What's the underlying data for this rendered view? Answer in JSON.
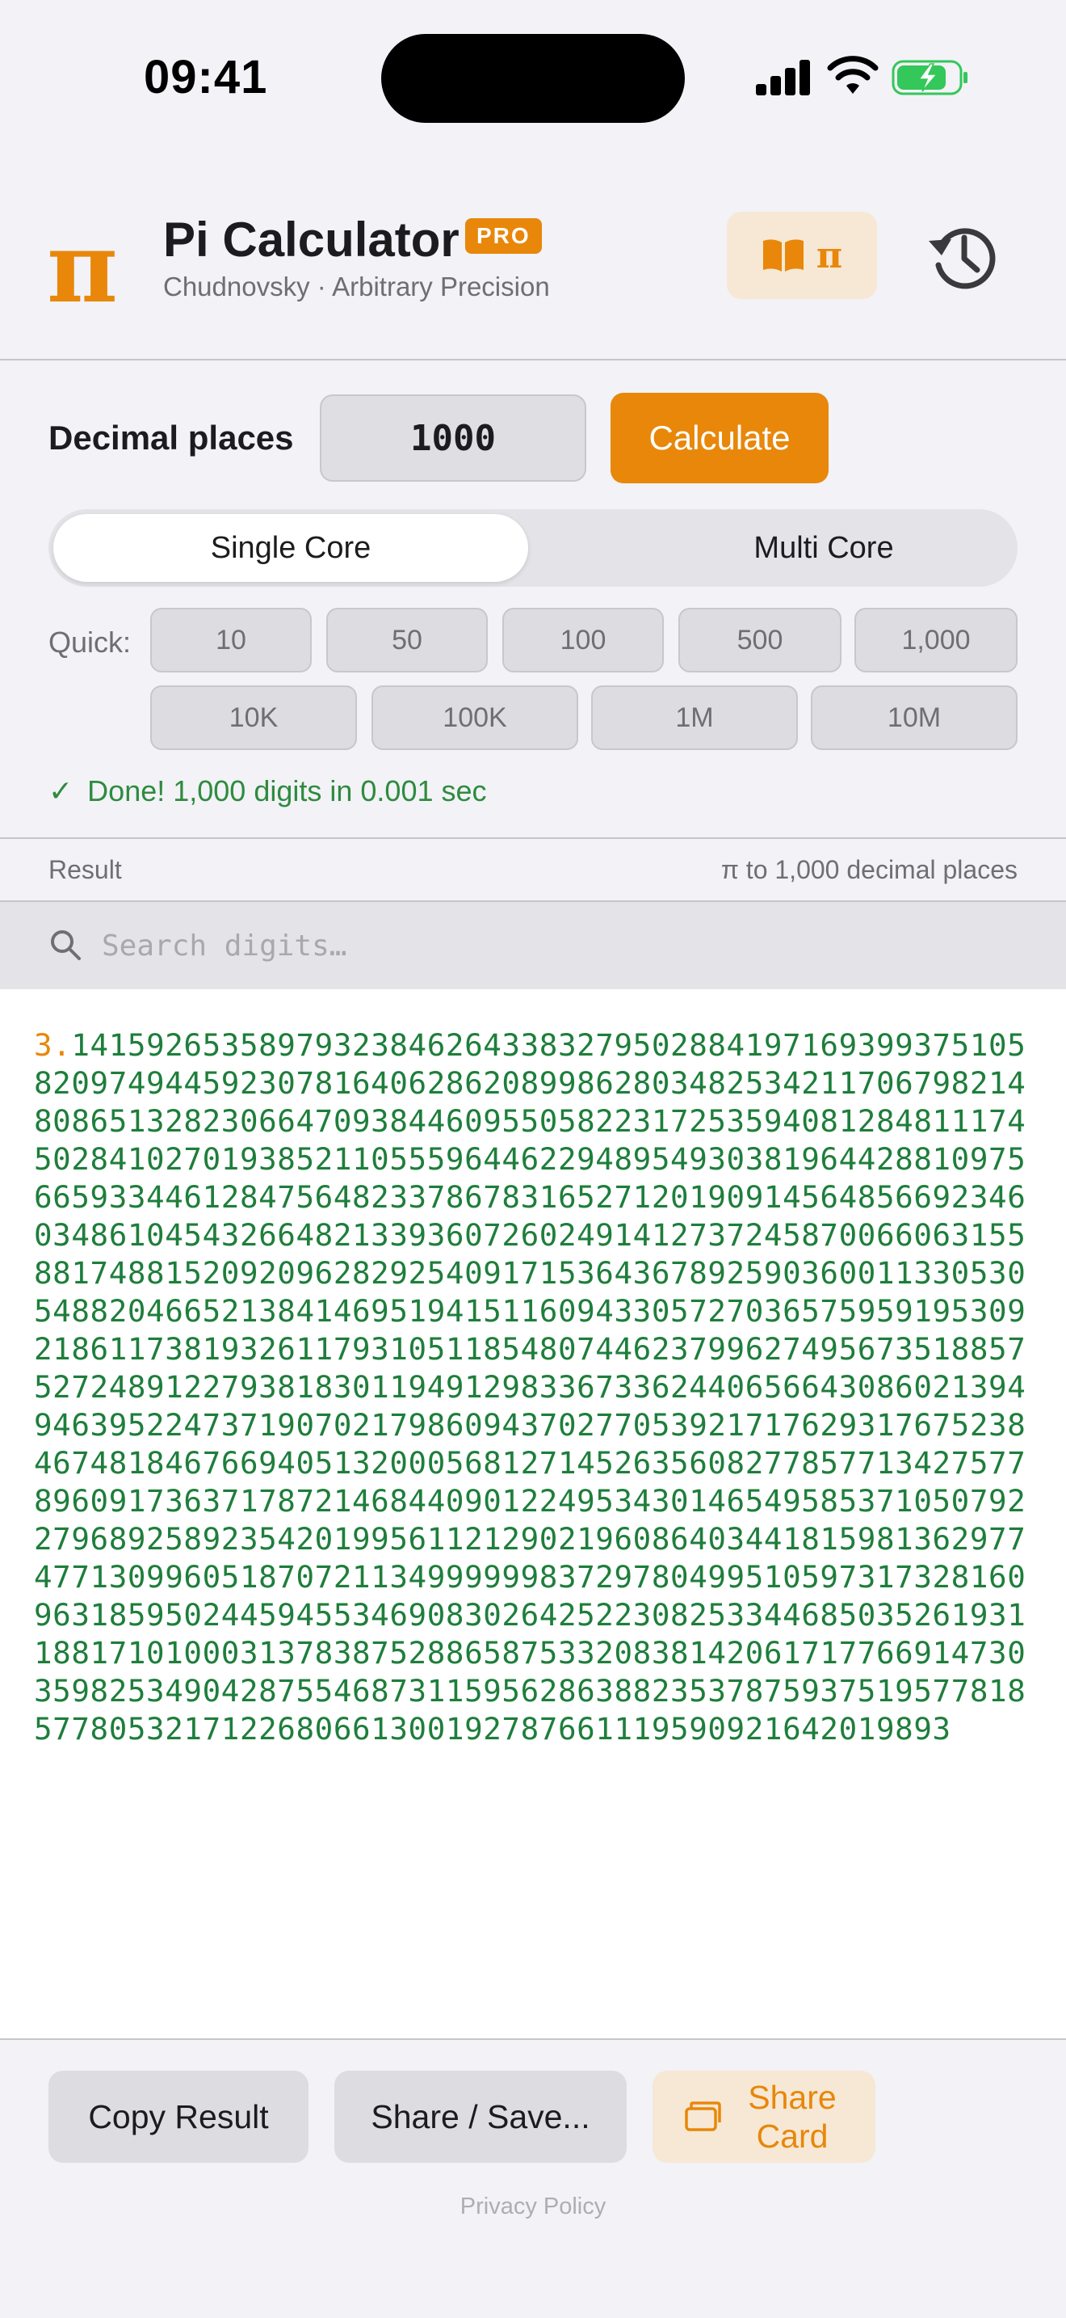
{
  "status_bar": {
    "time": "09:41"
  },
  "header": {
    "logo_glyph": "π",
    "title": "Pi Calculator",
    "badge": "PRO",
    "subtitle": "Chudnovsky · Arbitrary Precision",
    "book_button_glyph": "π",
    "icons": [
      "book-icon",
      "history-icon"
    ]
  },
  "controls": {
    "decimal_places_label": "Decimal places",
    "decimal_places_value": "1000",
    "calculate_label": "Calculate",
    "modes": [
      {
        "label": "Single Core",
        "selected": true
      },
      {
        "label": "Multi Core",
        "selected": false
      }
    ],
    "quick_label": "Quick:",
    "quick_row1": [
      "10",
      "50",
      "100",
      "500",
      "1,000"
    ],
    "quick_row2": [
      "10K",
      "100K",
      "1M",
      "10M"
    ],
    "status_check": "✓",
    "status_text": "Done! 1,000 digits in 0.001 sec"
  },
  "result": {
    "label": "Result",
    "info": "π to 1,000 decimal places",
    "search_placeholder": "Search digits…",
    "integer_part": "3.",
    "digits": "14159265358979323846264338327950288419716939937510582097494459230781640628620899862803482534211706798214808651328230664709384460955058223172535940812848111745028410270193852110555964462294895493038196442881097566593344612847564823378678316527120190914564856692346034861045432664821339360726024914127372458700660631558817488152092096282925409171536436789259036001133053054882046652138414695194151160943305727036575959195309218611738193261179310511854807446237996274956735188575272489122793818301194912983367336244065664308602139494639522473719070217986094370277053921717629317675238467481846766940513200056812714526356082778577134275778960917363717872146844090122495343014654958537105079227968925892354201995611212902196086403441815981362977477130996051870721134999999837297804995105973173281609631859502445945534690830264252230825334468503526193118817101000313783875288658753320838142061717766914730359825349042875546873115956286388235378759375195778185778053217122680661300192787661119590921642019893"
  },
  "footer": {
    "copy_label": "Copy Result",
    "share_label": "Share / Save...",
    "card_label": "Share Card",
    "privacy_label": "Privacy Policy"
  },
  "colors": {
    "accent": "#e8870a",
    "digits": "#1e7e3b",
    "success": "#2e8b3e",
    "background": "#f2f2f7"
  }
}
